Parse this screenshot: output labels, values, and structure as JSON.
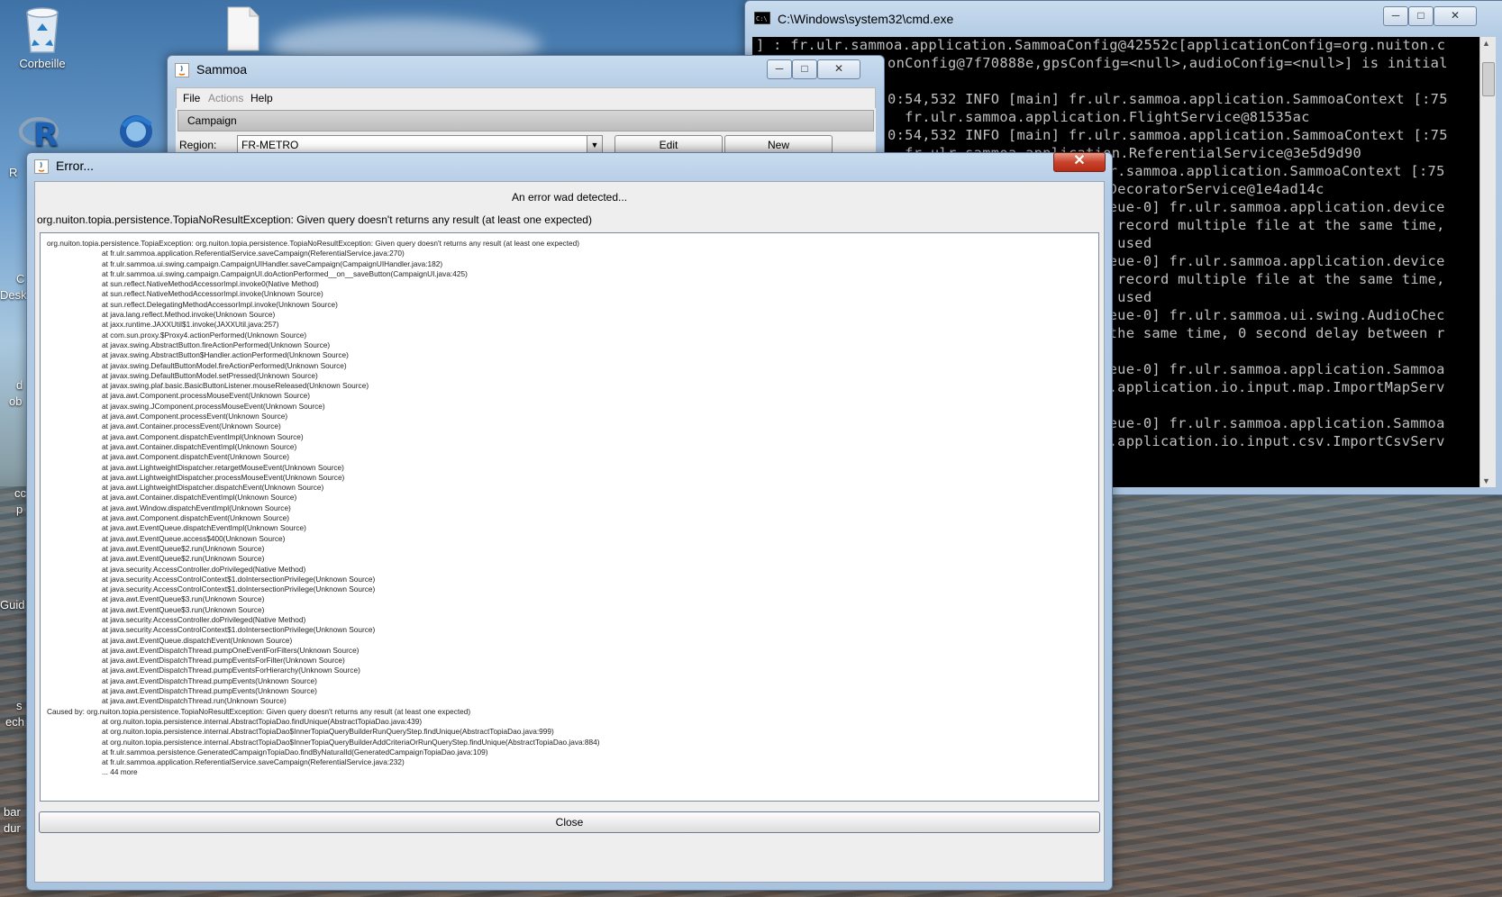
{
  "desktop": {
    "recycle_bin_label": "Corbeille",
    "edge_fragments": [
      "R",
      "C",
      "Desk",
      "d",
      "ob",
      "cc",
      "p",
      "Guid",
      "s",
      "ech",
      "bar",
      "dur"
    ]
  },
  "cmd_window": {
    "title": "C:\\Windows\\system32\\cmd.exe",
    "lines": [
      "] : fr.ulr.sammoa.application.SammoaConfig@42552c[applicationConfig=org.nuiton.c",
      "onConfig@7f70888e,gpsConfig=<null>,audioConfig=<null>] is initial",
      "0:54,532 INFO [main] fr.ulr.sammoa.application.SammoaContext [:75",
      "  fr.ulr.sammoa.application.FlightService@81535ac",
      "0:54,532 INFO [main] fr.ulr.sammoa.application.SammoaContext [:75",
      "  fr.ulr.sammoa.application.ReferentialService@3e5d9d90",
      "lr.sammoa.application.SammoaContext [:75",
      "IDecoratorService@1e4ad14c",
      "ueue-0] fr.ulr.sammoa.application.device",
      "t record multiple file at the same time,",
      "e used",
      "ueue-0] fr.ulr.sammoa.application.device",
      "t record multiple file at the same time,",
      "e used",
      "ueue-0] fr.ulr.sammoa.ui.swing.AudioChec",
      " the same time, 0 second delay between r",
      "",
      "ueue-0] fr.ulr.sammoa.application.Sammoa",
      "a.application.io.input.map.ImportMapServ",
      "",
      "ueue-0] fr.ulr.sammoa.application.Sammoa",
      "a.application.io.input.csv.ImportCsvServ"
    ]
  },
  "sammoa_window": {
    "title": "Sammoa",
    "menu": [
      "File",
      "Actions",
      "Help"
    ],
    "tab_title": "Campaign",
    "region_label": "Region:",
    "region_value": "FR-METRO",
    "edit_label": "Edit",
    "new_label": "New"
  },
  "error_dialog": {
    "title": "Error...",
    "headline": "An error wad detected...",
    "message": "org.nuiton.topia.persistence.TopiaNoResultException: Given query doesn't returns any result (at least one expected)",
    "close_label": "Close",
    "trace": [
      {
        "indent": false,
        "text": "org.nuiton.topia.persistence.TopiaException: org.nuiton.topia.persistence.TopiaNoResultException: Given query doesn't returns any result (at least one expected)"
      },
      {
        "indent": true,
        "text": "at fr.ulr.sammoa.application.ReferentialService.saveCampaign(ReferentialService.java:270)"
      },
      {
        "indent": true,
        "text": "at fr.ulr.sammoa.ui.swing.campaign.CampaignUIHandler.saveCampaign(CampaignUIHandler.java:182)"
      },
      {
        "indent": true,
        "text": "at fr.ulr.sammoa.ui.swing.campaign.CampaignUI.doActionPerformed__on__saveButton(CampaignUI.java:425)"
      },
      {
        "indent": true,
        "text": "at sun.reflect.NativeMethodAccessorImpl.invoke0(Native Method)"
      },
      {
        "indent": true,
        "text": "at sun.reflect.NativeMethodAccessorImpl.invoke(Unknown Source)"
      },
      {
        "indent": true,
        "text": "at sun.reflect.DelegatingMethodAccessorImpl.invoke(Unknown Source)"
      },
      {
        "indent": true,
        "text": "at java.lang.reflect.Method.invoke(Unknown Source)"
      },
      {
        "indent": true,
        "text": "at jaxx.runtime.JAXXUtil$1.invoke(JAXXUtil.java:257)"
      },
      {
        "indent": true,
        "text": "at com.sun.proxy.$Proxy4.actionPerformed(Unknown Source)"
      },
      {
        "indent": true,
        "text": "at javax.swing.AbstractButton.fireActionPerformed(Unknown Source)"
      },
      {
        "indent": true,
        "text": "at javax.swing.AbstractButton$Handler.actionPerformed(Unknown Source)"
      },
      {
        "indent": true,
        "text": "at javax.swing.DefaultButtonModel.fireActionPerformed(Unknown Source)"
      },
      {
        "indent": true,
        "text": "at javax.swing.DefaultButtonModel.setPressed(Unknown Source)"
      },
      {
        "indent": true,
        "text": "at javax.swing.plaf.basic.BasicButtonListener.mouseReleased(Unknown Source)"
      },
      {
        "indent": true,
        "text": "at java.awt.Component.processMouseEvent(Unknown Source)"
      },
      {
        "indent": true,
        "text": "at javax.swing.JComponent.processMouseEvent(Unknown Source)"
      },
      {
        "indent": true,
        "text": "at java.awt.Component.processEvent(Unknown Source)"
      },
      {
        "indent": true,
        "text": "at java.awt.Container.processEvent(Unknown Source)"
      },
      {
        "indent": true,
        "text": "at java.awt.Component.dispatchEventImpl(Unknown Source)"
      },
      {
        "indent": true,
        "text": "at java.awt.Container.dispatchEventImpl(Unknown Source)"
      },
      {
        "indent": true,
        "text": "at java.awt.Component.dispatchEvent(Unknown Source)"
      },
      {
        "indent": true,
        "text": "at java.awt.LightweightDispatcher.retargetMouseEvent(Unknown Source)"
      },
      {
        "indent": true,
        "text": "at java.awt.LightweightDispatcher.processMouseEvent(Unknown Source)"
      },
      {
        "indent": true,
        "text": "at java.awt.LightweightDispatcher.dispatchEvent(Unknown Source)"
      },
      {
        "indent": true,
        "text": "at java.awt.Container.dispatchEventImpl(Unknown Source)"
      },
      {
        "indent": true,
        "text": "at java.awt.Window.dispatchEventImpl(Unknown Source)"
      },
      {
        "indent": true,
        "text": "at java.awt.Component.dispatchEvent(Unknown Source)"
      },
      {
        "indent": true,
        "text": "at java.awt.EventQueue.dispatchEventImpl(Unknown Source)"
      },
      {
        "indent": true,
        "text": "at java.awt.EventQueue.access$400(Unknown Source)"
      },
      {
        "indent": true,
        "text": "at java.awt.EventQueue$2.run(Unknown Source)"
      },
      {
        "indent": true,
        "text": "at java.awt.EventQueue$2.run(Unknown Source)"
      },
      {
        "indent": true,
        "text": "at java.security.AccessController.doPrivileged(Native Method)"
      },
      {
        "indent": true,
        "text": "at java.security.AccessControlContext$1.doIntersectionPrivilege(Unknown Source)"
      },
      {
        "indent": true,
        "text": "at java.security.AccessControlContext$1.doIntersectionPrivilege(Unknown Source)"
      },
      {
        "indent": true,
        "text": "at java.awt.EventQueue$3.run(Unknown Source)"
      },
      {
        "indent": true,
        "text": "at java.awt.EventQueue$3.run(Unknown Source)"
      },
      {
        "indent": true,
        "text": "at java.security.AccessController.doPrivileged(Native Method)"
      },
      {
        "indent": true,
        "text": "at java.security.AccessControlContext$1.doIntersectionPrivilege(Unknown Source)"
      },
      {
        "indent": true,
        "text": "at java.awt.EventQueue.dispatchEvent(Unknown Source)"
      },
      {
        "indent": true,
        "text": "at java.awt.EventDispatchThread.pumpOneEventForFilters(Unknown Source)"
      },
      {
        "indent": true,
        "text": "at java.awt.EventDispatchThread.pumpEventsForFilter(Unknown Source)"
      },
      {
        "indent": true,
        "text": "at java.awt.EventDispatchThread.pumpEventsForHierarchy(Unknown Source)"
      },
      {
        "indent": true,
        "text": "at java.awt.EventDispatchThread.pumpEvents(Unknown Source)"
      },
      {
        "indent": true,
        "text": "at java.awt.EventDispatchThread.pumpEvents(Unknown Source)"
      },
      {
        "indent": true,
        "text": "at java.awt.EventDispatchThread.run(Unknown Source)"
      },
      {
        "indent": false,
        "text": "Caused by: org.nuiton.topia.persistence.TopiaNoResultException: Given query doesn't returns any result (at least one expected)"
      },
      {
        "indent": true,
        "text": "at org.nuiton.topia.persistence.internal.AbstractTopiaDao.findUnique(AbstractTopiaDao.java:439)"
      },
      {
        "indent": true,
        "text": "at org.nuiton.topia.persistence.internal.AbstractTopiaDao$InnerTopiaQueryBuilderRunQueryStep.findUnique(AbstractTopiaDao.java:999)"
      },
      {
        "indent": true,
        "text": "at org.nuiton.topia.persistence.internal.AbstractTopiaDao$InnerTopiaQueryBuilderAddCriteriaOrRunQueryStep.findUnique(AbstractTopiaDao.java:884)"
      },
      {
        "indent": true,
        "text": "at fr.ulr.sammoa.persistence.GeneratedCampaignTopiaDao.findByNaturalId(GeneratedCampaignTopiaDao.java:109)"
      },
      {
        "indent": true,
        "text": "at fr.ulr.sammoa.application.ReferentialService.saveCampaign(ReferentialService.java:232)"
      },
      {
        "indent": true,
        "text": "... 44 more"
      }
    ]
  }
}
